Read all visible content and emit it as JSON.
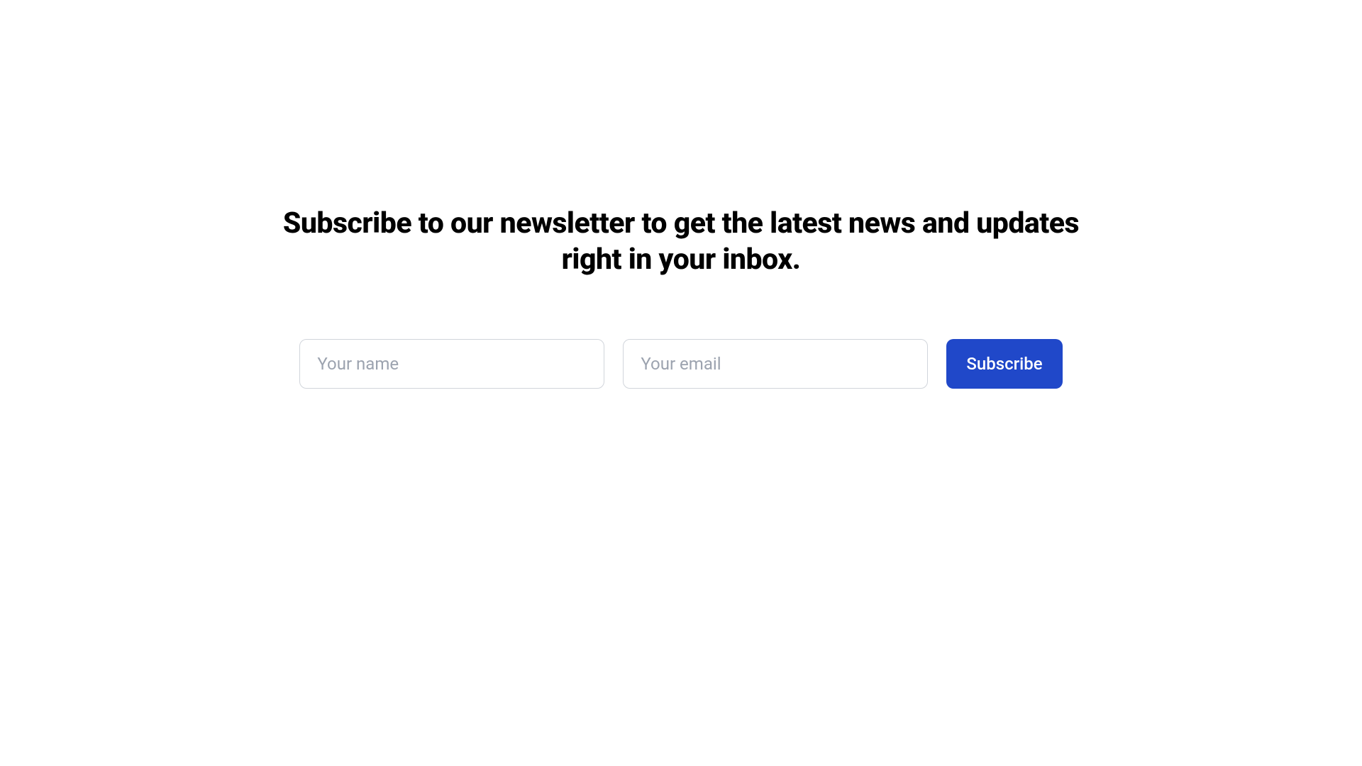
{
  "heading": "Subscribe to our newsletter to get the latest news and updates right in your inbox.",
  "form": {
    "name": {
      "placeholder": "Your name",
      "value": ""
    },
    "email": {
      "placeholder": "Your email",
      "value": ""
    },
    "submit_label": "Subscribe"
  },
  "colors": {
    "accent": "#2048c9",
    "placeholder": "#9ca3af",
    "border": "#d1d5db"
  }
}
